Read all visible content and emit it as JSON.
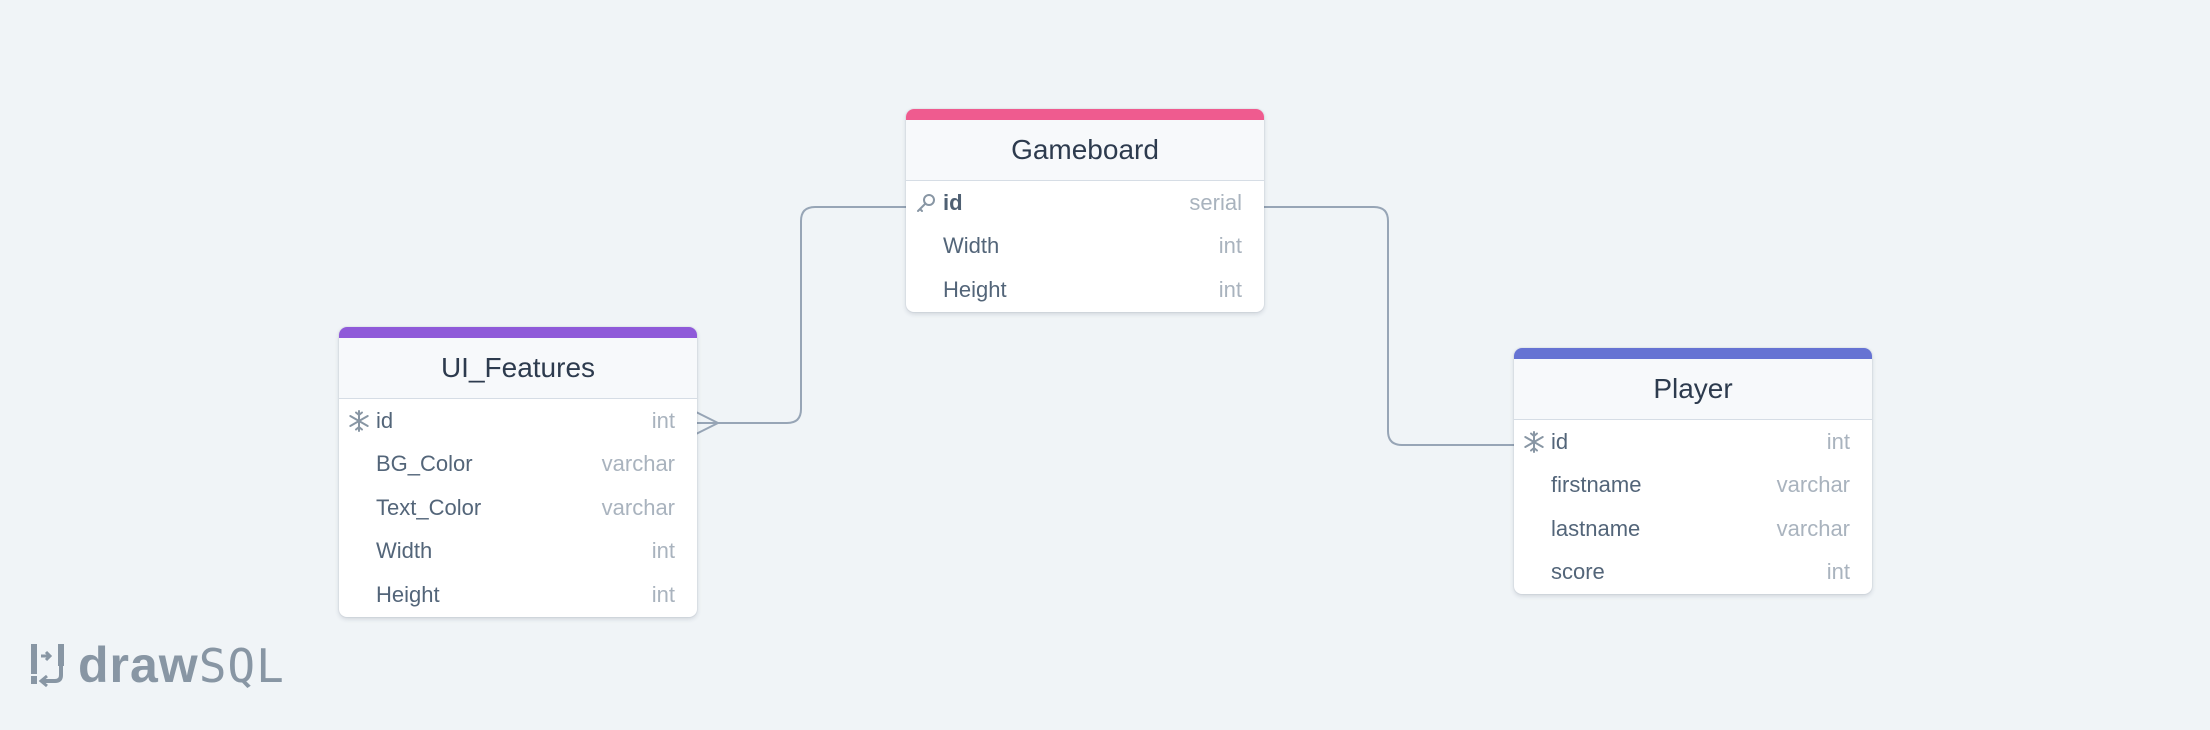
{
  "colors": {
    "gameboard": "#ef5b8f",
    "ui_features": "#8f5ad9",
    "player": "#6673d3",
    "connector": "#97a5b6"
  },
  "tables": {
    "gameboard": {
      "name": "Gameboard",
      "columns": [
        {
          "name": "id",
          "type": "serial",
          "key": "primary"
        },
        {
          "name": "Width",
          "type": "int"
        },
        {
          "name": "Height",
          "type": "int"
        }
      ]
    },
    "ui_features": {
      "name": "UI_Features",
      "columns": [
        {
          "name": "id",
          "type": "int",
          "key": "foreign"
        },
        {
          "name": "BG_Color",
          "type": "varchar"
        },
        {
          "name": "Text_Color",
          "type": "varchar"
        },
        {
          "name": "Width",
          "type": "int"
        },
        {
          "name": "Height",
          "type": "int"
        }
      ]
    },
    "player": {
      "name": "Player",
      "columns": [
        {
          "name": "id",
          "type": "int",
          "key": "foreign"
        },
        {
          "name": "firstname",
          "type": "varchar"
        },
        {
          "name": "lastname",
          "type": "varchar"
        },
        {
          "name": "score",
          "type": "int"
        }
      ]
    }
  },
  "relationships": [
    {
      "from": "gameboard.id",
      "to": "ui_features.id",
      "cardinality": "one-to-many"
    },
    {
      "from": "gameboard.id",
      "to": "player.id",
      "cardinality": "one-to-one"
    }
  ],
  "brand": {
    "bold": "draw",
    "light": "SQL"
  }
}
